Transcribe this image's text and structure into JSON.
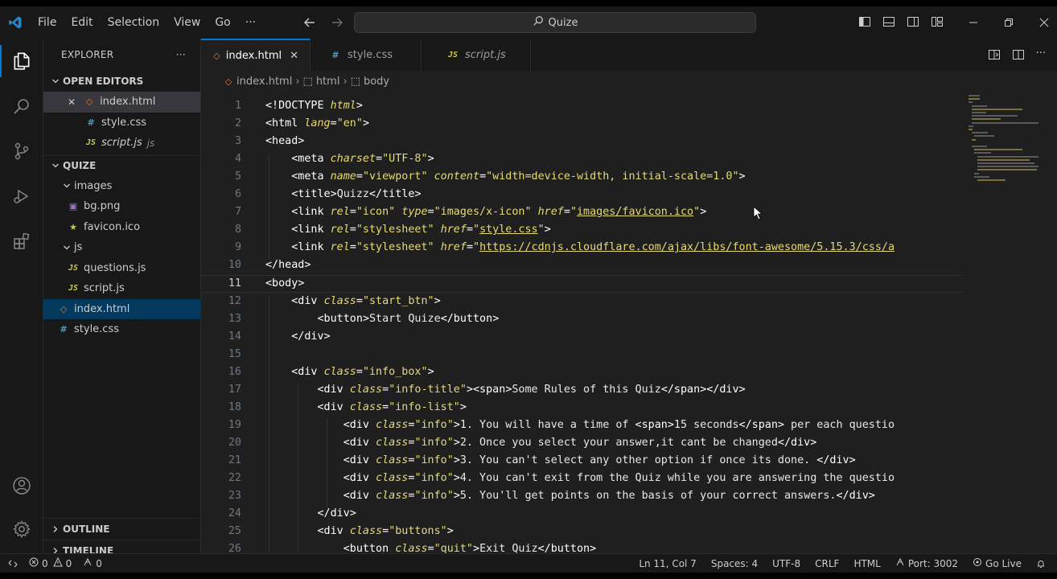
{
  "window": {
    "menu": [
      "File",
      "Edit",
      "Selection",
      "View",
      "Go",
      "···"
    ],
    "search_text": "Quize"
  },
  "sidebar": {
    "header": "EXPLORER",
    "header_more": "···",
    "open_editors_title": "OPEN EDITORS",
    "open_editors": [
      {
        "name": "index.html",
        "type": "html",
        "close": "✕"
      },
      {
        "name": "style.css",
        "type": "css"
      },
      {
        "name": "script.js",
        "type": "js",
        "path": "js"
      }
    ],
    "project_title": "QUIZE",
    "tree": [
      {
        "name": "images",
        "kind": "folder"
      },
      {
        "name": "bg.png",
        "kind": "png"
      },
      {
        "name": "favicon.ico",
        "kind": "ico"
      },
      {
        "name": "js",
        "kind": "folder"
      },
      {
        "name": "questions.js",
        "kind": "js"
      },
      {
        "name": "script.js",
        "kind": "js"
      },
      {
        "name": "index.html",
        "kind": "html"
      },
      {
        "name": "style.css",
        "kind": "css"
      }
    ],
    "outline_title": "OUTLINE",
    "timeline_title": "TIMELINE"
  },
  "tabs": [
    {
      "label": "index.html",
      "type": "html",
      "active": true,
      "close": "✕"
    },
    {
      "label": "style.css",
      "type": "css",
      "active": false
    },
    {
      "label": "script.js",
      "type": "js",
      "active": false
    }
  ],
  "breadcrumb": [
    "index.html",
    "html",
    "body"
  ],
  "editor": {
    "current_line": 11,
    "lines": [
      {
        "n": "1",
        "code": "<!DOCTYPE html>"
      },
      {
        "n": "2",
        "code": "<html lang=\"en\">"
      },
      {
        "n": "3",
        "code": "<head>"
      },
      {
        "n": "4",
        "code": "    <meta charset=\"UTF-8\">"
      },
      {
        "n": "5",
        "code": "    <meta name=\"viewport\" content=\"width=device-width, initial-scale=1.0\">"
      },
      {
        "n": "6",
        "code": "    <title>Quizz</title>"
      },
      {
        "n": "7",
        "code": "    <link rel=\"icon\" type=\"images/x-icon\" href=\"images/favicon.ico\">"
      },
      {
        "n": "8",
        "code": "    <link rel=\"stylesheet\" href=\"style.css\">"
      },
      {
        "n": "9",
        "code": "    <link rel=\"stylesheet\" href=\"https://cdnjs.cloudflare.com/ajax/libs/font-awesome/5.15.3/css/a"
      },
      {
        "n": "10",
        "code": "</head>"
      },
      {
        "n": "11",
        "code": "<body>"
      },
      {
        "n": "12",
        "code": "    <div class=\"start_btn\">"
      },
      {
        "n": "13",
        "code": "        <button>Start Quize</button>"
      },
      {
        "n": "14",
        "code": "    </div>"
      },
      {
        "n": "15",
        "code": ""
      },
      {
        "n": "16",
        "code": "    <div class=\"info_box\">"
      },
      {
        "n": "17",
        "code": "        <div class=\"info-title\"><span>Some Rules of this Quiz</span></div>"
      },
      {
        "n": "18",
        "code": "        <div class=\"info-list\">"
      },
      {
        "n": "19",
        "code": "            <div class=\"info\">1. You will have a time of <span>15 seconds</span> per each questio"
      },
      {
        "n": "20",
        "code": "            <div class=\"info\">2. Once you select your answer,it cant be changed</div>"
      },
      {
        "n": "21",
        "code": "            <div class=\"info\">3. You can't select any other option if once its done. </div>"
      },
      {
        "n": "22",
        "code": "            <div class=\"info\">4. You can't exit from the Quiz while you are answering the questio"
      },
      {
        "n": "23",
        "code": "            <div class=\"info\">5. You'll get points on the basis of your correct answers.</div>"
      },
      {
        "n": "24",
        "code": "        </div>"
      },
      {
        "n": "25",
        "code": "        <div class=\"buttons\">"
      },
      {
        "n": "26",
        "code": "            <button class=\"quit\">Exit Quiz</button>"
      }
    ]
  },
  "statusbar": {
    "errors": "0",
    "warnings": "0",
    "ports": "0",
    "position": "Ln 11, Col 7",
    "spaces": "Spaces: 4",
    "encoding": "UTF-8",
    "eol": "CRLF",
    "language": "HTML",
    "port": "Port: 3002",
    "golive": "Go Live"
  },
  "colors": {
    "accent": "#0078d4",
    "background": "#1f1f1f",
    "chrome": "#181818",
    "string": "#e6db74"
  }
}
